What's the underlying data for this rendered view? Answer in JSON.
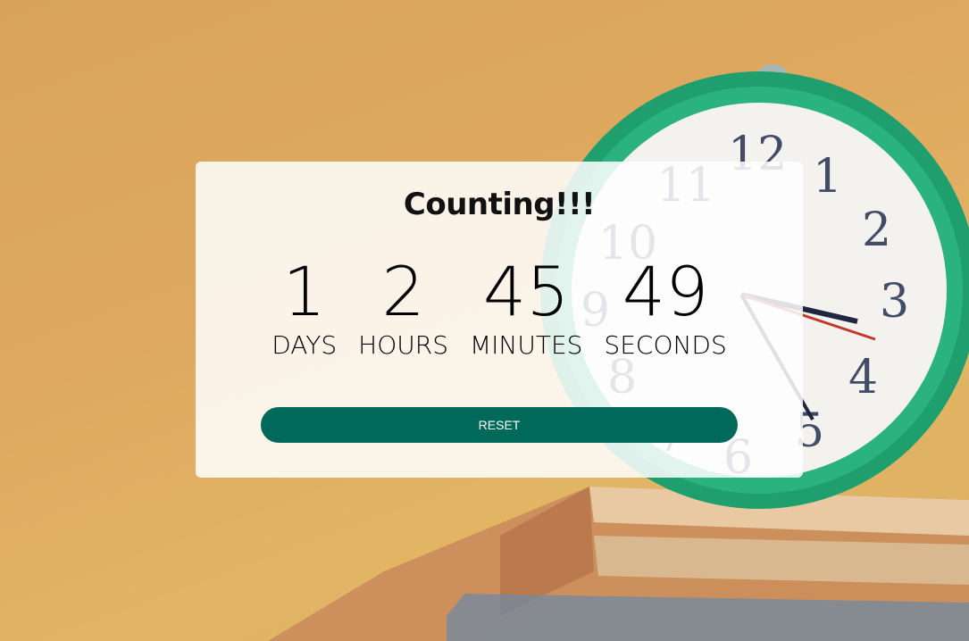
{
  "countdown": {
    "title": "Counting!!!",
    "units": [
      {
        "value": "1",
        "label": "DAYS"
      },
      {
        "value": "2",
        "label": "HOURS"
      },
      {
        "value": "45",
        "label": "MINUTES"
      },
      {
        "value": "49",
        "label": "SECONDS"
      }
    ],
    "reset_label": "RESET"
  },
  "colors": {
    "button": "#00695a",
    "background": "#dea95f",
    "clock_case": "#20a070"
  }
}
